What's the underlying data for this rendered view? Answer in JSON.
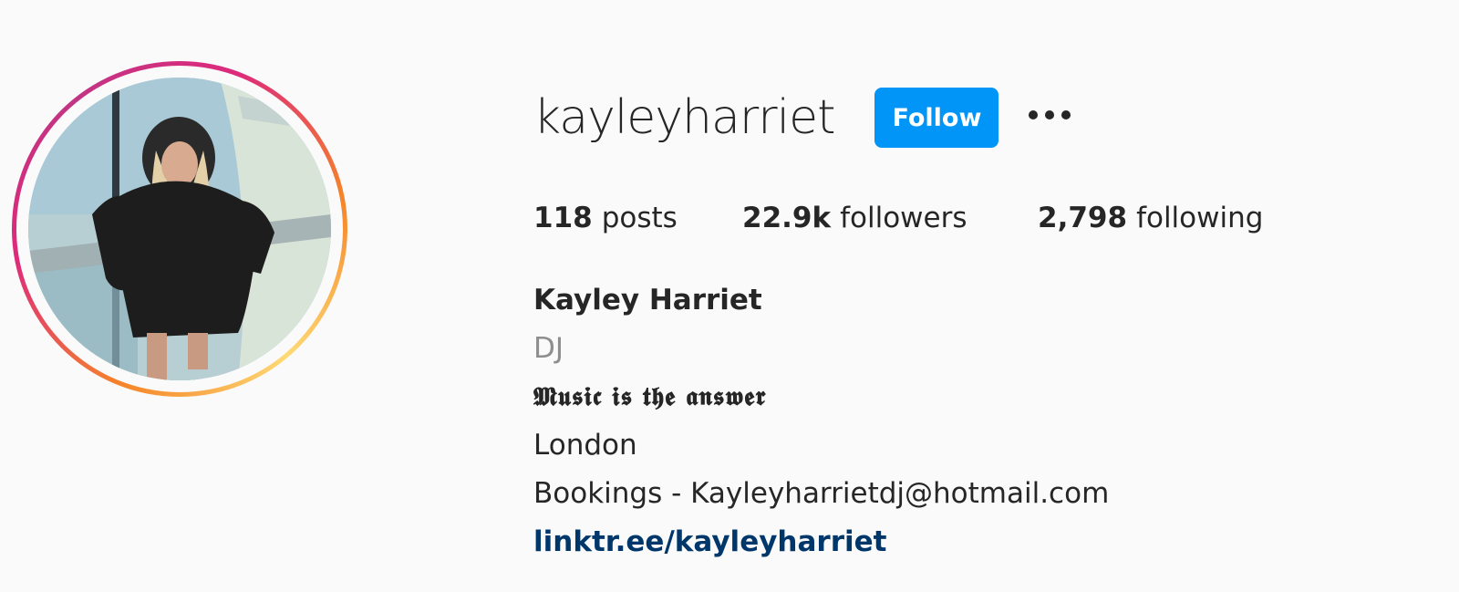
{
  "profile": {
    "username": "kayleyharriet",
    "follow_label": "Follow",
    "more_options": "more-horizontal-icon",
    "stats": {
      "posts_count": "118",
      "posts_label": "posts",
      "followers_count": "22.9k",
      "followers_label": "followers",
      "following_count": "2,798",
      "following_label": "following"
    },
    "bio": {
      "name": "Kayley Harriet",
      "category": "DJ",
      "tagline": "𝕸𝖚𝖘𝖎𝖈 𝖎𝖘 𝖙𝖍𝖊 𝖆𝖓𝖘𝖜𝖊𝖗",
      "location": "London",
      "contact": "Bookings - Kayleyharrietdj@hotmail.com",
      "link": "linktr.ee/kayleyharriet"
    }
  },
  "colors": {
    "follow_button": "#0095f6",
    "link": "#00376b",
    "category_text": "#8e8e8e",
    "story_ring_start": "#f58529",
    "story_ring_end": "#c13584"
  }
}
